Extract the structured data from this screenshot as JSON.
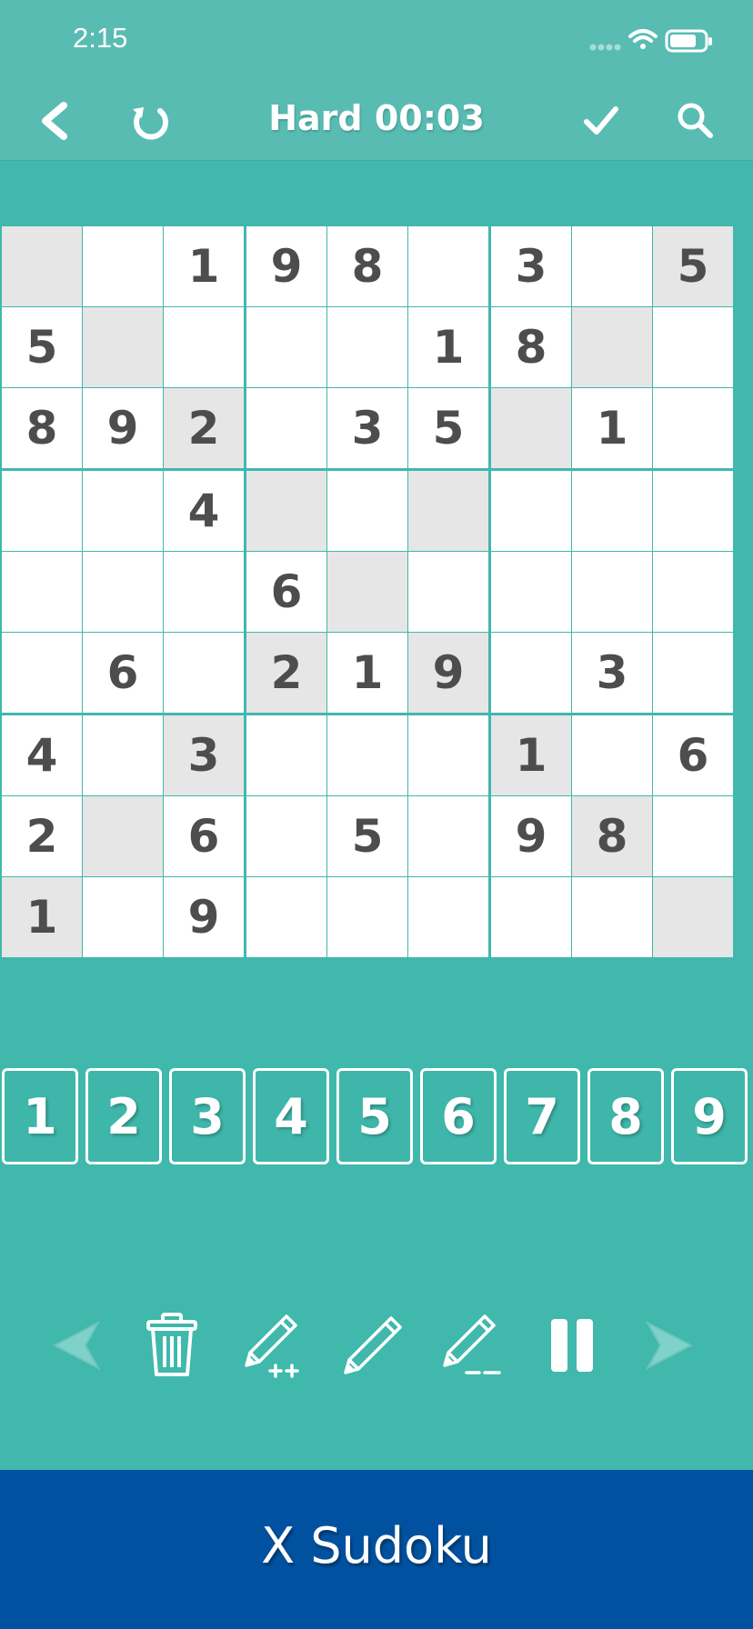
{
  "status_bar": {
    "time": "2:15",
    "icons": [
      "signal-dots-icon",
      "wifi-icon",
      "battery-icon"
    ]
  },
  "nav": {
    "title": "Hard 00:03",
    "back_icon": "chevron-left-icon",
    "restart_icon": "refresh-icon",
    "check_icon": "checkmark-icon",
    "search_icon": "magnifier-icon"
  },
  "board": {
    "rows": [
      [
        "",
        "",
        "1",
        "9",
        "8",
        "",
        "3",
        "",
        "5"
      ],
      [
        "5",
        "",
        "",
        "",
        "",
        "1",
        "8",
        "",
        ""
      ],
      [
        "8",
        "9",
        "2",
        "",
        "3",
        "5",
        "",
        "1",
        ""
      ],
      [
        "",
        "",
        "4",
        "",
        "",
        "",
        "",
        "",
        ""
      ],
      [
        "",
        "",
        "",
        "6",
        "",
        "",
        "",
        "",
        ""
      ],
      [
        "",
        "6",
        "",
        "2",
        "1",
        "9",
        "",
        "3",
        ""
      ],
      [
        "4",
        "",
        "3",
        "",
        "",
        "",
        "1",
        "",
        "6"
      ],
      [
        "2",
        "",
        "6",
        "",
        "5",
        "",
        "9",
        "8",
        ""
      ],
      [
        "1",
        "",
        "9",
        "",
        "",
        "",
        "",
        "",
        ""
      ]
    ],
    "diagonal_shaded": true,
    "colors": {
      "shaded": "#e6e6e6",
      "cell": "#ffffff",
      "grid": "#40b8ac",
      "digit": "#4d4d4d"
    }
  },
  "keypad": {
    "keys": [
      "1",
      "2",
      "3",
      "4",
      "5",
      "6",
      "7",
      "8",
      "9"
    ]
  },
  "toolbar": {
    "tools": [
      "undo-arrow-icon",
      "trash-icon",
      "pencil-plus-icon",
      "pencil-icon",
      "pencil-erase-icon",
      "pause-icon",
      "redo-arrow-icon"
    ]
  },
  "banner": {
    "title": "X Sudoku",
    "color": "#0052a0"
  },
  "colors": {
    "background": "#40b8ac",
    "header": "#58bcb3"
  }
}
